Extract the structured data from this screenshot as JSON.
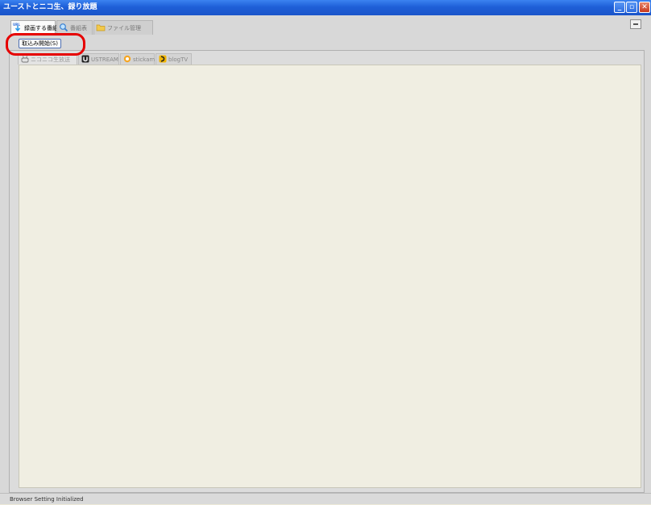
{
  "window": {
    "title": "ユーストとニコ生、録り放題",
    "controls": {
      "minimize": "_",
      "maximize": "▫",
      "close": "✕"
    }
  },
  "main_tabs": [
    {
      "label": "録画する番組",
      "icon": "url-download-icon",
      "active": true
    },
    {
      "label": "番組表",
      "icon": "magnifier-icon",
      "active": false
    },
    {
      "label": "ファイル管理",
      "icon": "folder-icon",
      "active": false
    }
  ],
  "start_button": {
    "label": "取込み開始(S)"
  },
  "service_tabs": [
    {
      "label": "ニコニコ生放送",
      "icon": "niconico-icon",
      "active": true
    },
    {
      "label": "USTREAM",
      "icon": "ustream-icon",
      "active": false
    },
    {
      "label": "stickam",
      "icon": "stickam-icon",
      "active": false
    },
    {
      "label": "blogTV",
      "icon": "blogtv-icon",
      "active": false
    }
  ],
  "status_bar": {
    "text": "Browser Setting Initialized"
  },
  "colors": {
    "title_bar": "#1e5fd8",
    "content_bg": "#f0eee2",
    "highlight": "#e60000"
  }
}
